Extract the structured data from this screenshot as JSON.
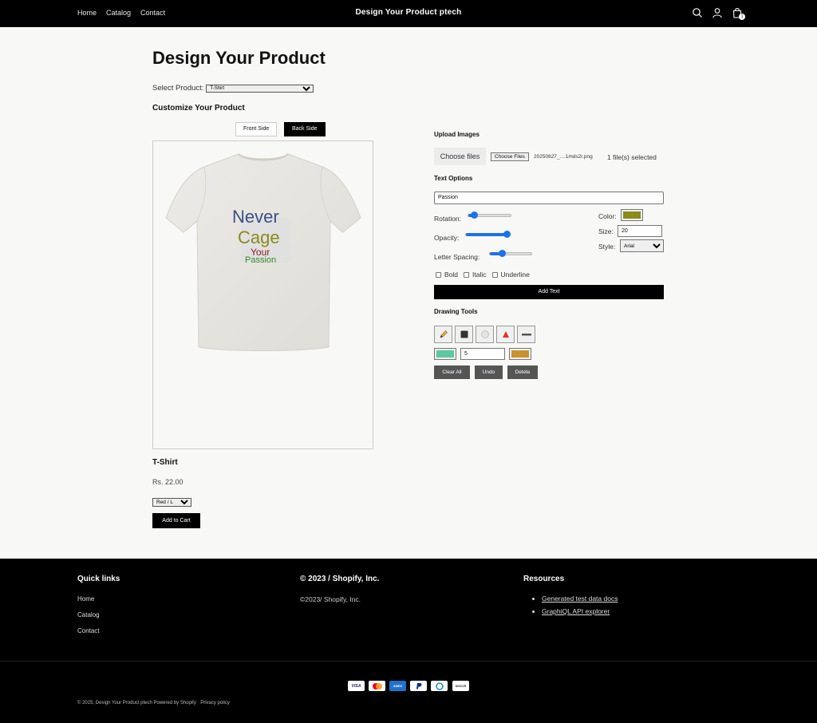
{
  "header": {
    "nav": [
      "Home",
      "Catalog",
      "Contact"
    ],
    "brand": "Design Your Product ptech",
    "cart_count": "1"
  },
  "main": {
    "title": "Design Your Product",
    "select_label": "Select Product:",
    "selected_product": "T-Shirt",
    "customize_heading": "Customize Your Product",
    "front_label": "Front Side",
    "back_label": "Back Side",
    "active_side": "Back Side",
    "canvas_text": {
      "line1": "Never",
      "line2": "Cage",
      "line3": "Your",
      "line4": "Passion"
    },
    "product_name": "T-Shirt",
    "price": "Rs. 22.00",
    "variant": "Red / L",
    "add_to_cart": "Add to Cart"
  },
  "panel": {
    "upload_heading": "Upload Images",
    "choose_files": "Choose files",
    "file_input_button": "Choose Files",
    "file_name": "20250627_....1mds2r.png",
    "files_selected": "1 file(s) selected",
    "text_heading": "Text Options",
    "text_value": "Passion",
    "rotation_label": "Rotation:",
    "opacity_label": "Opacity:",
    "spacing_label": "Letter Spacing:",
    "rotation_level": 0.15,
    "opacity_level": 1.0,
    "spacing_level": 0.3,
    "color_label": "Color:",
    "text_color": "#8b8a1a",
    "size_label": "Size:",
    "size_value": "20",
    "style_label": "Style:",
    "style_value": "Arial",
    "bold": "Bold",
    "italic": "Italic",
    "underline": "Underline",
    "add_text": "Add Text",
    "drawing_heading": "Drawing Tools",
    "tools": [
      "pencil-icon",
      "square-icon",
      "circle-icon",
      "triangle-icon",
      "line-icon"
    ],
    "fill_color": "#5ec8a0",
    "stroke_width": "5",
    "stroke_color": "#c8922e",
    "clear_all": "Clear All",
    "undo": "Undo",
    "delete": "Delete"
  },
  "footer": {
    "quick_links_heading": "Quick links",
    "quick_links": [
      "Home",
      "Catalog",
      "Contact"
    ],
    "company_heading": "© 2023 / Shopify, Inc.",
    "company_text": "©2023/ Shopify, Inc.",
    "resources_heading": "Resources",
    "resources": [
      "Generated test data docs",
      "GraphiQL API explorer"
    ],
    "payments": [
      "visa",
      "mastercard",
      "amex",
      "paypal",
      "diners",
      "discover"
    ],
    "bottom_text": "© 2025, Design Your Product ptech Powered by Shopify",
    "privacy": "Privacy policy"
  }
}
